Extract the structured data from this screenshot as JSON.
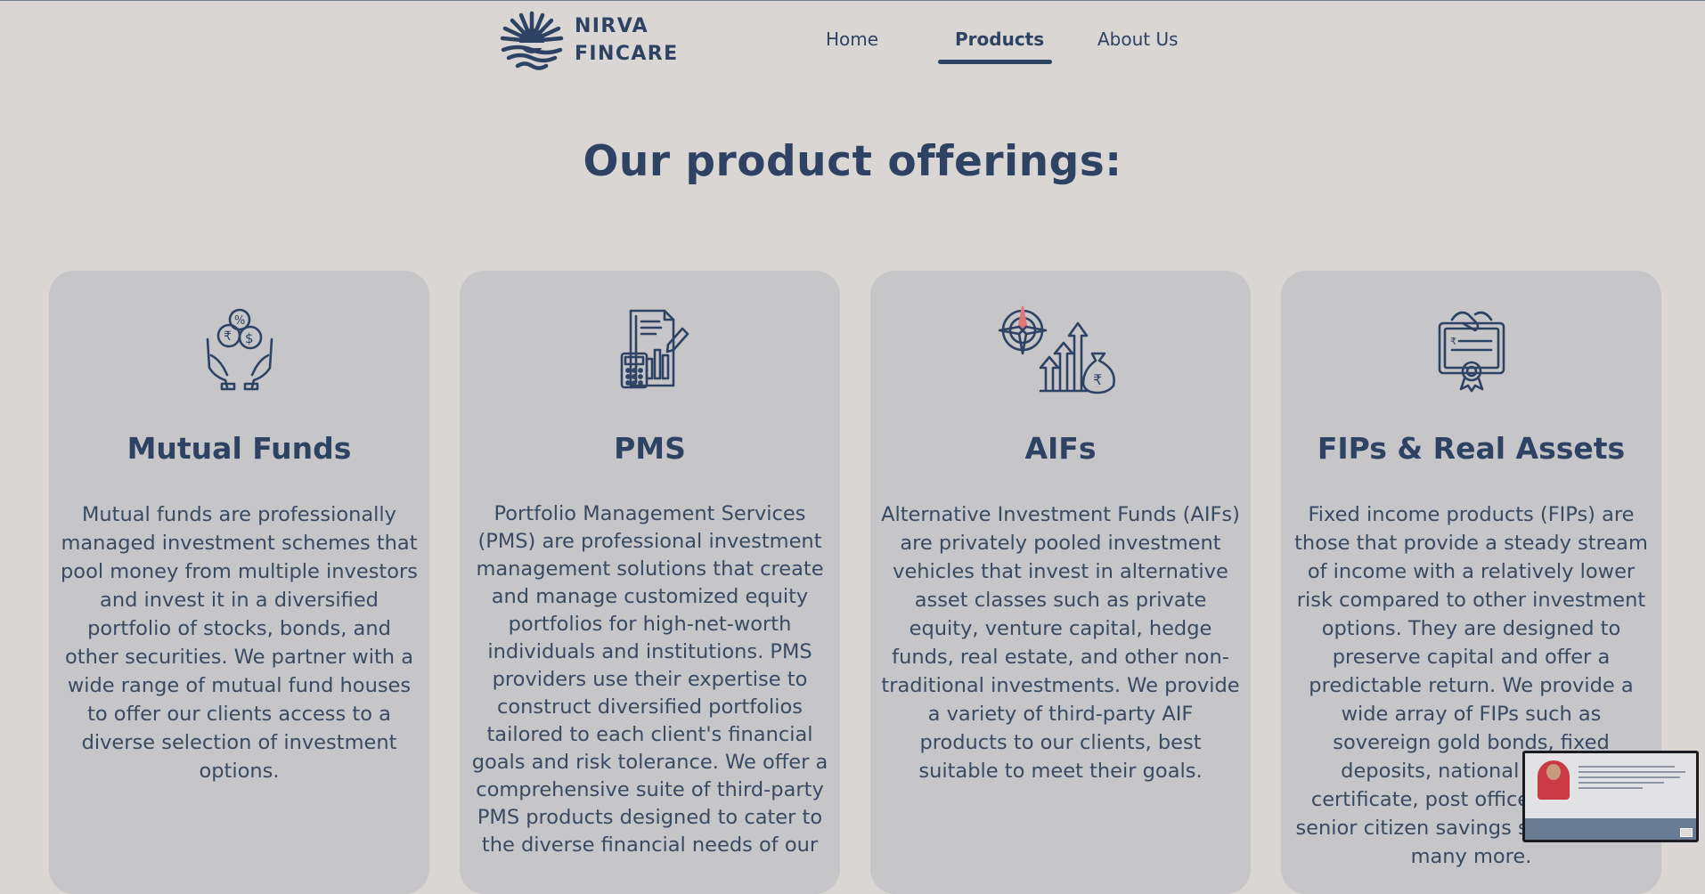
{
  "brand": {
    "line1": "NIRVA",
    "line2": "FINCARE"
  },
  "nav": [
    {
      "label": "Home",
      "active": false
    },
    {
      "label": "Products",
      "active": true
    },
    {
      "label": "About Us",
      "active": false
    }
  ],
  "page_title": "Our product offerings:",
  "cards": [
    {
      "title": "Mutual Funds",
      "icon": "hands-coins-icon",
      "text": "Mutual funds are professionally managed investment schemes that pool money from multiple investors and invest it in a diversified portfolio of stocks, bonds, and other securities. We partner with a wide range of mutual fund houses to offer our clients access to a diverse selection of investment options."
    },
    {
      "title": "PMS",
      "icon": "report-calculator-icon",
      "text": "Portfolio Management Services (PMS) are professional investment management solutions that create and manage customized equity portfolios for high-net-worth individuals and institutions. PMS providers use their expertise to construct diversified portfolios tailored to each client's financial goals and risk tolerance. We offer a comprehensive suite of third-party PMS products designed to cater to the diverse financial needs of our"
    },
    {
      "title": "AIFs",
      "icon": "compass-growth-icon",
      "text": "Alternative Investment Funds (AIFs) are privately pooled investment vehicles that invest in alternative asset classes such as private equity, venture capital, hedge funds, real estate, and other non-traditional investments. We provide a variety of third-party AIF products to our clients, best suitable to meet their goals."
    },
    {
      "title": "FIPs & Real Assets",
      "icon": "certificate-handshake-icon",
      "text": "Fixed income products (FIPs) are those that provide a steady stream of income with a relatively lower risk compared to other investment options. They are designed to preserve capital and offer a predictable return. We provide a wide array of FIPs such as sovereign gold bonds, fixed deposits, national savings certificate, post office schemes, senior citizen savings scheme, and many more."
    }
  ],
  "colors": {
    "background": "#d9d6d4",
    "card": "#c6c5c8",
    "primary": "#2e4363",
    "accent": "#e07a7a"
  }
}
